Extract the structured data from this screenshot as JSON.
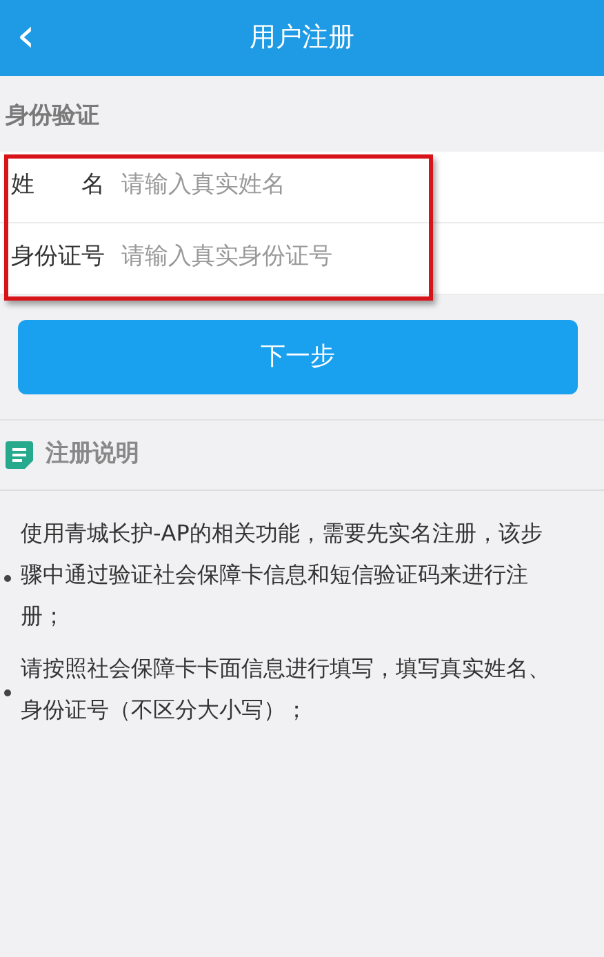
{
  "header": {
    "back_icon": "‹",
    "title": "用户注册"
  },
  "section_title": "身份验证",
  "form": {
    "highlighted": true,
    "fields": [
      {
        "label": "姓　　名",
        "placeholder": "请输入真实姓名"
      },
      {
        "label": "身份证号",
        "placeholder": "请输入真实身份证号"
      }
    ]
  },
  "next_button": "下一步",
  "notes": {
    "title": "注册说明",
    "items": [
      "使用青城长护-AP的相关功能，需要先实名注册，该步骤中通过验证社会保障卡信息和短信验证码来进行注册；",
      "请按照社会保障卡卡面信息进行填写，填写真实姓名、身份证号（不区分大小写）；"
    ]
  }
}
